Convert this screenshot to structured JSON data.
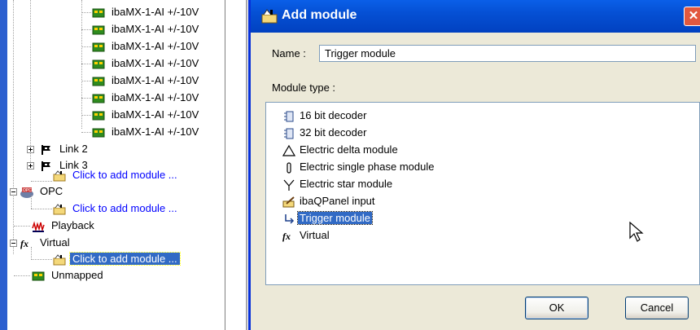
{
  "tree": {
    "sublabel": "ibaMX-1-AI +/-10V",
    "link2": "Link 2",
    "link3": "Link 3",
    "add_module": "Click to add module ...",
    "opc": "OPC",
    "playback": "Playback",
    "virtual": "Virtual",
    "unmapped": "Unmapped"
  },
  "dialog": {
    "title": "Add module",
    "close": "✕",
    "name_label": "Name :",
    "name_value": "Trigger module",
    "type_label": "Module type :",
    "module_types": [
      "16 bit decoder",
      "32 bit decoder",
      "Electric delta module",
      "Electric single phase module",
      "Electric star module",
      "ibaQPanel input",
      "Trigger module",
      "Virtual"
    ],
    "ok": "OK",
    "cancel": "Cancel"
  }
}
